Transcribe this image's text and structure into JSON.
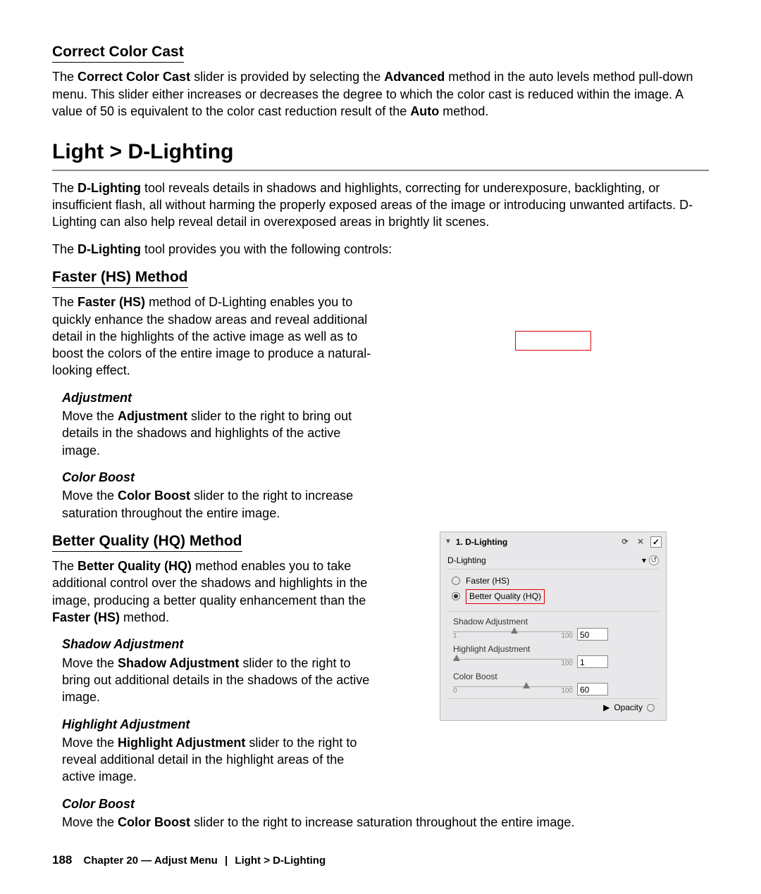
{
  "sections": {
    "correctColorCast": {
      "title": "Correct Color Cast",
      "para_pre": "The ",
      "para_b1": "Correct Color Cast",
      "para_mid1": " slider is provided by selecting the ",
      "para_b2": "Advanced",
      "para_mid2": " method in the auto levels method pull-down menu. This slider either increases or decreases the degree to which the color cast is reduced within the image. A value of 50 is equivalent to the color cast reduction result of the ",
      "para_b3": "Auto",
      "para_post": " method."
    },
    "dlighting": {
      "heading": "Light > D-Lighting",
      "intro_pre": "The ",
      "intro_b": "D-Lighting",
      "intro_post": " tool reveals details in shadows and highlights, correcting for underexposure, backlighting, or insufficient flash, all without harming the properly exposed areas of the image or introducing unwanted artifacts. D-Lighting can also help reveal detail in overexposed areas in brightly lit scenes.",
      "controls_pre": "The ",
      "controls_b": "D-Lighting",
      "controls_post": " tool provides you with the following controls:"
    },
    "fasterHS": {
      "title": "Faster (HS) Method",
      "para_pre": "The ",
      "para_b": "Faster (HS)",
      "para_post": " method of D-Lighting enables you to quickly enhance the shadow areas and reveal additional detail in the highlights of the active image as well as to boost the colors of the entire image to produce a natural-looking effect.",
      "adjustment": {
        "title": "Adjustment",
        "para_pre": "Move the ",
        "para_b": "Adjustment",
        "para_post": " slider to the right to bring out details in the shadows and highlights of the active image."
      },
      "colorBoost": {
        "title": "Color Boost",
        "para_pre": "Move the ",
        "para_b": "Color Boost",
        "para_post": " slider to the right to increase saturation throughout the entire image."
      }
    },
    "betterHQ": {
      "title": "Better Quality (HQ) Method",
      "para_pre": "The ",
      "para_b1": "Better Quality (HQ)",
      "para_mid": " method enables you to take additional control over the shadows and highlights in the image, producing a better quality enhancement than the ",
      "para_b2": "Faster (HS)",
      "para_post": " method.",
      "shadowAdj": {
        "title": "Shadow Adjustment",
        "para_pre": "Move the ",
        "para_b": "Shadow Adjustment",
        "para_post": " slider to the right to bring out additional details in the shadows of the active image."
      },
      "highlightAdj": {
        "title": "Highlight Adjustment",
        "para_pre": "Move the ",
        "para_b": "Highlight Adjustment",
        "para_post": " slider to the right to reveal additional detail in the highlight areas of the active image."
      },
      "colorBoost2": {
        "title": "Color Boost",
        "para_pre": "Move the ",
        "para_b": "Color Boost",
        "para_post": " slider to the right to increase saturation throughout the entire image."
      }
    }
  },
  "panel": {
    "title": "1. D-Lighting",
    "dropdown": "D-Lighting",
    "radio_faster": "Faster (HS)",
    "radio_hq": "Better Quality (HQ)",
    "sliders": {
      "shadow": {
        "label": "Shadow Adjustment",
        "min": "1",
        "max": "100",
        "value": "50"
      },
      "highlight": {
        "label": "Highlight Adjustment",
        "min": "",
        "max": "100",
        "value": "1"
      },
      "colorBoost": {
        "label": "Color Boost",
        "min": "0",
        "max": "100",
        "value": "60"
      }
    },
    "opacity_label": "Opacity"
  },
  "footer": {
    "page": "188",
    "chapter": "Chapter 20 — Adjust Menu",
    "crumb": "Light > D-Lighting"
  }
}
